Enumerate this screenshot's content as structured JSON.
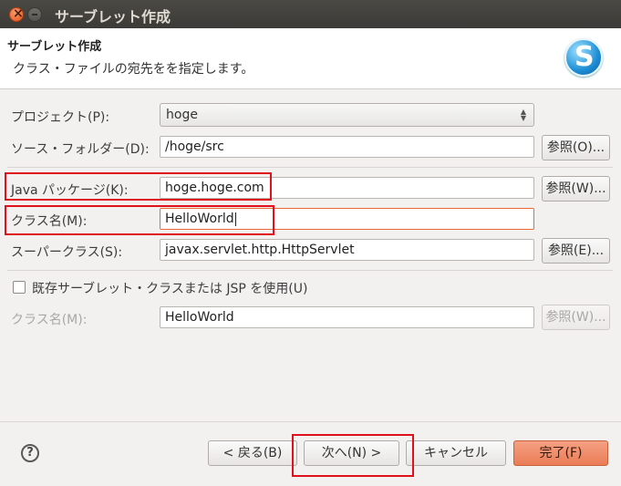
{
  "window": {
    "title": "サーブレット作成"
  },
  "header": {
    "title": "サーブレット作成",
    "description": "クラス・ファイルの宛先をを指定します。",
    "logo_letter": "S"
  },
  "form": {
    "project": {
      "label": "プロジェクト(P):",
      "value": "hoge"
    },
    "source_folder": {
      "label": "ソース・フォルダー(D):",
      "value": "/hoge/src",
      "browse": "参照(O)..."
    },
    "java_package": {
      "label": "Java パッケージ(K):",
      "value": "hoge.hoge.com",
      "browse": "参照(W)..."
    },
    "class_name": {
      "label": "クラス名(M):",
      "value": "HelloWorld"
    },
    "superclass": {
      "label": "スーパークラス(S):",
      "value": "javax.servlet.http.HttpServlet",
      "browse": "参照(E)..."
    },
    "existing_servlet": {
      "label": "既存サーブレット・クラスまたは JSP を使用(U)",
      "checked": false
    },
    "existing_class_name": {
      "label": "クラス名(M):",
      "value": "HelloWorld",
      "browse": "参照(W)..."
    }
  },
  "footer": {
    "help_icon": "help-icon",
    "back": "< 戻る(B)",
    "next": "次へ(N) >",
    "cancel": "キャンセル",
    "finish": "完了(F)"
  },
  "colors": {
    "accent": "#ea7c56",
    "highlight": "#e0101d",
    "titlebar": "#3c3b37"
  }
}
